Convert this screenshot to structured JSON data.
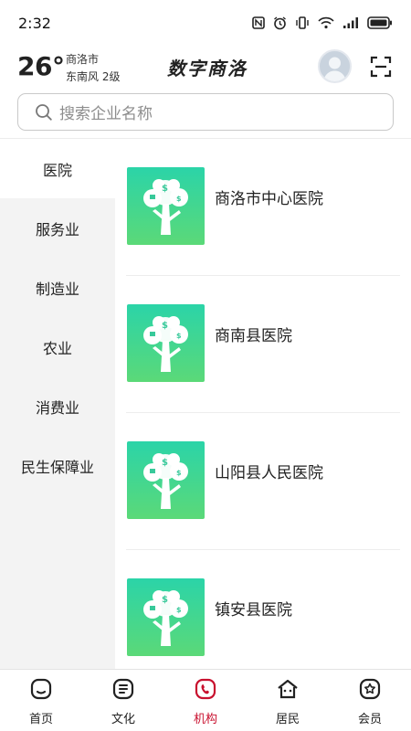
{
  "status_bar": {
    "time": "2:32"
  },
  "header": {
    "temperature": "26°",
    "city": "商洛市",
    "wind": "东南风  2级",
    "title": "数字商洛"
  },
  "search": {
    "placeholder": "搜索企业名称"
  },
  "sidebar": {
    "items": [
      {
        "label": "医院",
        "active": true
      },
      {
        "label": "服务业",
        "active": false
      },
      {
        "label": "制造业",
        "active": false
      },
      {
        "label": "农业",
        "active": false
      },
      {
        "label": "消费业",
        "active": false
      },
      {
        "label": "民生保障业",
        "active": false
      }
    ]
  },
  "list": {
    "items": [
      {
        "name": "商洛市中心医院"
      },
      {
        "name": "商南县医院"
      },
      {
        "name": "山阳县人民医院"
      },
      {
        "name": "镇安县医院"
      }
    ]
  },
  "bottom_nav": {
    "items": [
      {
        "label": "首页",
        "icon": "home-icon",
        "active": false
      },
      {
        "label": "文化",
        "icon": "culture-icon",
        "active": false
      },
      {
        "label": "机构",
        "icon": "institution-icon",
        "active": true
      },
      {
        "label": "居民",
        "icon": "resident-icon",
        "active": false
      },
      {
        "label": "会员",
        "icon": "member-icon",
        "active": false
      }
    ]
  },
  "colors": {
    "accent": "#c8102e",
    "thumb_gradient_top": "#2bd4a8",
    "thumb_gradient_bottom": "#5bd978",
    "sidebar_bg": "#f3f3f3"
  }
}
